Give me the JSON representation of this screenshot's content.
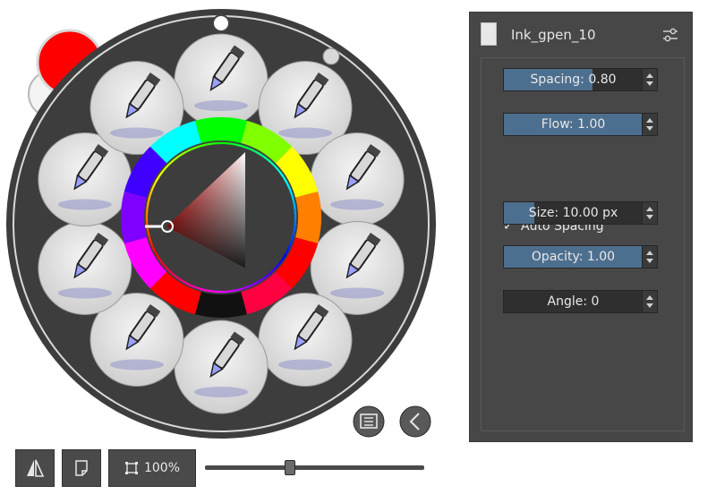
{
  "palette": {
    "foreground_color": "#ff0000",
    "background_color": "#ffffff",
    "ring_color": "#3d3d3d",
    "brushes": [
      "preset-pen-top",
      "preset-marker-top-right",
      "preset-pencil-right",
      "preset-marker-right",
      "preset-marker-bottom-right",
      "preset-marker-bottom",
      "preset-ink-bottom-left",
      "preset-blender-left",
      "preset-ink-pen-left",
      "preset-pencil-top-left"
    ],
    "tag_selector_icon": "list-icon",
    "collapse_icon": "chevron-left-icon"
  },
  "brush_editor": {
    "preset_name": "Ink_gpen_10",
    "settings_icon": "sliders-icon",
    "spacing": {
      "label": "Spacing: 0.80",
      "level": 0.58
    },
    "flow": {
      "label": "Flow: 1.00",
      "level": 1.0
    },
    "auto_spacing": {
      "label": "Auto Spacing",
      "checked": true,
      "mark": "✓"
    },
    "size": {
      "label": "Size: 10.00 px",
      "level": 0.2
    },
    "opacity": {
      "label": "Opacity: 1.00",
      "level": 1.0
    },
    "angle": {
      "label": "Angle: 0",
      "level": 0.0
    }
  },
  "toolbar": {
    "mirror_icon": "mirror-icon",
    "canvas_only_icon": "page-icon",
    "zoom_label": "100%",
    "zoom_icon": "fit-icon",
    "zoom_slider_level": 0.39
  }
}
